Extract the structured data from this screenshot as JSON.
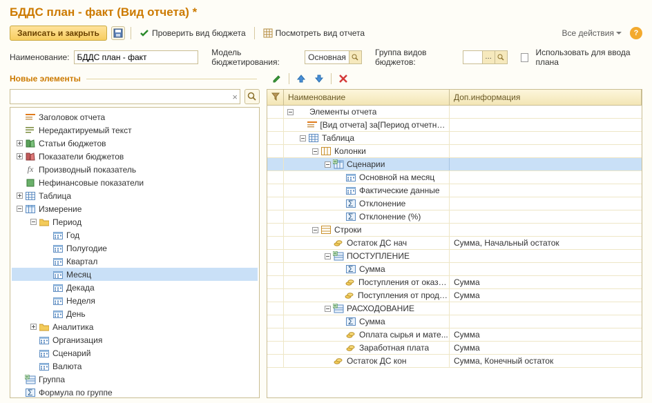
{
  "title": "БДДС план - факт (Вид отчета) *",
  "toolbar": {
    "save_close": "Записать и закрыть",
    "check": "Проверить вид бюджета",
    "view": "Посмотреть вид отчета",
    "all_actions": "Все действия"
  },
  "form": {
    "name_label": "Наименование:",
    "name_value": "БДДС план - факт",
    "model_label": "Модель бюджетирования:",
    "model_value": "Основная",
    "group_label": "Группа видов бюджетов:",
    "group_value": "",
    "checkbox_label": "Использовать для ввода плана"
  },
  "section": "Новые элементы",
  "left_tree": [
    {
      "d": 0,
      "exp": "",
      "icon": "header",
      "label": "Заголовок отчета"
    },
    {
      "d": 0,
      "exp": "",
      "icon": "text",
      "label": "Нередактируемый текст"
    },
    {
      "d": 0,
      "exp": "plus",
      "icon": "book-green",
      "label": "Статьи бюджетов"
    },
    {
      "d": 0,
      "exp": "plus",
      "icon": "book-red",
      "label": "Показатели бюджетов"
    },
    {
      "d": 0,
      "exp": "",
      "icon": "fx",
      "label": "Производный показатель"
    },
    {
      "d": 0,
      "exp": "",
      "icon": "green-sq",
      "label": "Нефинансовые показатели"
    },
    {
      "d": 0,
      "exp": "plus",
      "icon": "table",
      "label": "Таблица"
    },
    {
      "d": 0,
      "exp": "minus",
      "icon": "dim",
      "label": "Измерение"
    },
    {
      "d": 1,
      "exp": "minus",
      "icon": "folder",
      "label": "Период"
    },
    {
      "d": 2,
      "exp": "",
      "icon": "calendar",
      "label": "Год"
    },
    {
      "d": 2,
      "exp": "",
      "icon": "calendar",
      "label": "Полугодие"
    },
    {
      "d": 2,
      "exp": "",
      "icon": "calendar",
      "label": "Квартал"
    },
    {
      "d": 2,
      "exp": "",
      "icon": "calendar",
      "label": "Месяц",
      "selected": true
    },
    {
      "d": 2,
      "exp": "",
      "icon": "calendar",
      "label": "Декада"
    },
    {
      "d": 2,
      "exp": "",
      "icon": "calendar",
      "label": "Неделя"
    },
    {
      "d": 2,
      "exp": "",
      "icon": "calendar",
      "label": "День"
    },
    {
      "d": 1,
      "exp": "plus",
      "icon": "folder",
      "label": "Аналитика"
    },
    {
      "d": 1,
      "exp": "",
      "icon": "calendar",
      "label": "Организация"
    },
    {
      "d": 1,
      "exp": "",
      "icon": "calendar",
      "label": "Сценарий"
    },
    {
      "d": 1,
      "exp": "",
      "icon": "calendar",
      "label": "Валюта"
    },
    {
      "d": 0,
      "exp": "",
      "icon": "group",
      "label": "Группа"
    },
    {
      "d": 0,
      "exp": "",
      "icon": "sigma",
      "label": "Формула по группе"
    }
  ],
  "grid_headers": {
    "c2": "Наименование",
    "c3": "Доп.информация"
  },
  "right_grid": [
    {
      "d": 0,
      "exp": "minus",
      "icon": "none",
      "label": "Элементы отчета",
      "info": ""
    },
    {
      "d": 1,
      "exp": "",
      "icon": "header",
      "label": "[Вид отчета] за[Период отчетности]",
      "info": ""
    },
    {
      "d": 1,
      "exp": "minus",
      "icon": "table",
      "label": "Таблица",
      "info": ""
    },
    {
      "d": 2,
      "exp": "minus",
      "icon": "cols",
      "label": "Колонки",
      "info": ""
    },
    {
      "d": 3,
      "exp": "minus",
      "icon": "dim-plus",
      "label": "Сценарии",
      "info": "",
      "selected": true
    },
    {
      "d": 4,
      "exp": "",
      "icon": "calendar",
      "label": "Основной на месяц",
      "info": ""
    },
    {
      "d": 4,
      "exp": "",
      "icon": "calendar",
      "label": "Фактические данные",
      "info": ""
    },
    {
      "d": 4,
      "exp": "",
      "icon": "sigma-sm",
      "label": "Отклонение",
      "info": ""
    },
    {
      "d": 4,
      "exp": "",
      "icon": "sigma-sm",
      "label": "Отклонение (%)",
      "info": ""
    },
    {
      "d": 2,
      "exp": "minus",
      "icon": "rows",
      "label": "Строки",
      "info": ""
    },
    {
      "d": 3,
      "exp": "",
      "icon": "coins",
      "label": "Остаток ДС нач",
      "info": "Сумма, Начальный остаток"
    },
    {
      "d": 3,
      "exp": "minus",
      "icon": "group-plus",
      "label": "ПОСТУПЛЕНИЕ",
      "info": ""
    },
    {
      "d": 4,
      "exp": "",
      "icon": "sigma-sm",
      "label": "Сумма",
      "info": ""
    },
    {
      "d": 4,
      "exp": "",
      "icon": "coins",
      "label": "Поступления от оказа...",
      "info": "Сумма"
    },
    {
      "d": 4,
      "exp": "",
      "icon": "coins",
      "label": "Поступления от прода...",
      "info": "Сумма"
    },
    {
      "d": 3,
      "exp": "minus",
      "icon": "group-plus",
      "label": "РАСХОДОВАНИЕ",
      "info": ""
    },
    {
      "d": 4,
      "exp": "",
      "icon": "sigma-sm",
      "label": "Сумма",
      "info": ""
    },
    {
      "d": 4,
      "exp": "",
      "icon": "coins",
      "label": "Оплата сырья и мате...",
      "info": "Сумма"
    },
    {
      "d": 4,
      "exp": "",
      "icon": "coins",
      "label": "Заработная плата",
      "info": "Сумма"
    },
    {
      "d": 3,
      "exp": "",
      "icon": "coins",
      "label": "Остаток ДС кон",
      "info": "Сумма, Конечный остаток"
    }
  ]
}
